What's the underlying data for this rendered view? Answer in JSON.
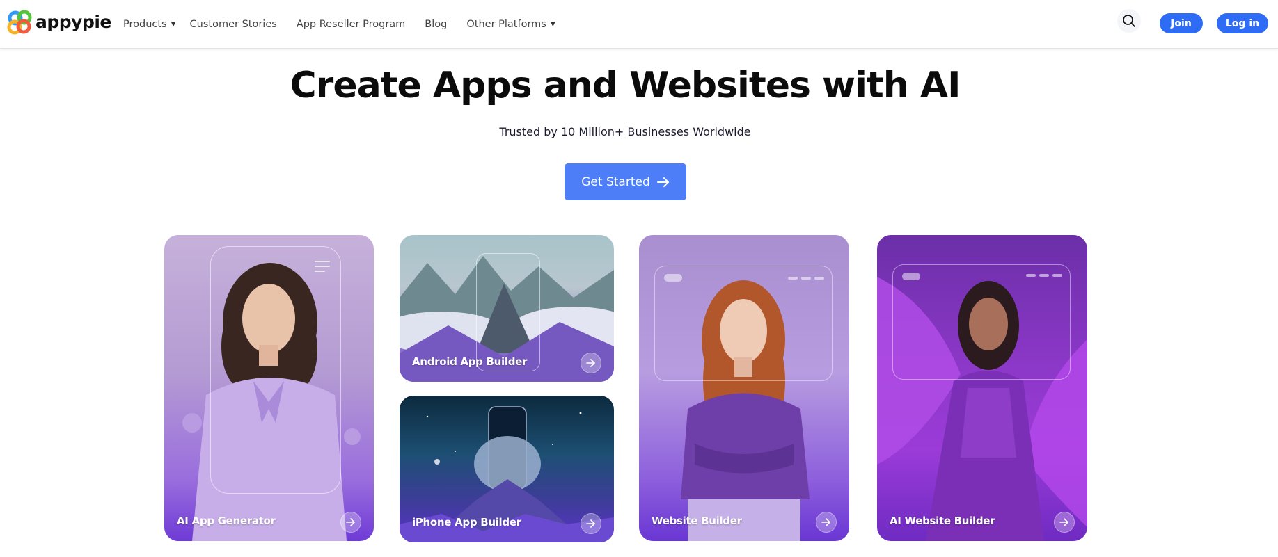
{
  "brand": {
    "name": "appypie"
  },
  "nav": {
    "items": [
      {
        "label": "Products",
        "has_dropdown": true
      },
      {
        "label": "Customer Stories",
        "has_dropdown": false
      },
      {
        "label": "App Reseller Program",
        "has_dropdown": false
      },
      {
        "label": "Blog",
        "has_dropdown": false
      },
      {
        "label": "Other Platforms",
        "has_dropdown": true
      }
    ]
  },
  "header_actions": {
    "search_icon": "search-icon",
    "join_label": "Join",
    "login_label": "Log in"
  },
  "hero": {
    "title": "Create Apps and Websites with AI",
    "subtitle": "Trusted by 10 Million+ Businesses Worldwide",
    "cta_label": "Get Started"
  },
  "cards": [
    {
      "label": "AI App Generator",
      "icon": "arrow-right-icon"
    },
    {
      "label": "Android App Builder",
      "icon": "arrow-right-icon"
    },
    {
      "label": "iPhone App Builder",
      "icon": "arrow-right-icon"
    },
    {
      "label": "Website Builder",
      "icon": "arrow-right-icon"
    },
    {
      "label": "AI Website Builder",
      "icon": "arrow-right-icon"
    }
  ],
  "colors": {
    "accent": "#2f6cf6",
    "cta": "#4d7ef7",
    "card_purple": "#6f3bd6"
  }
}
